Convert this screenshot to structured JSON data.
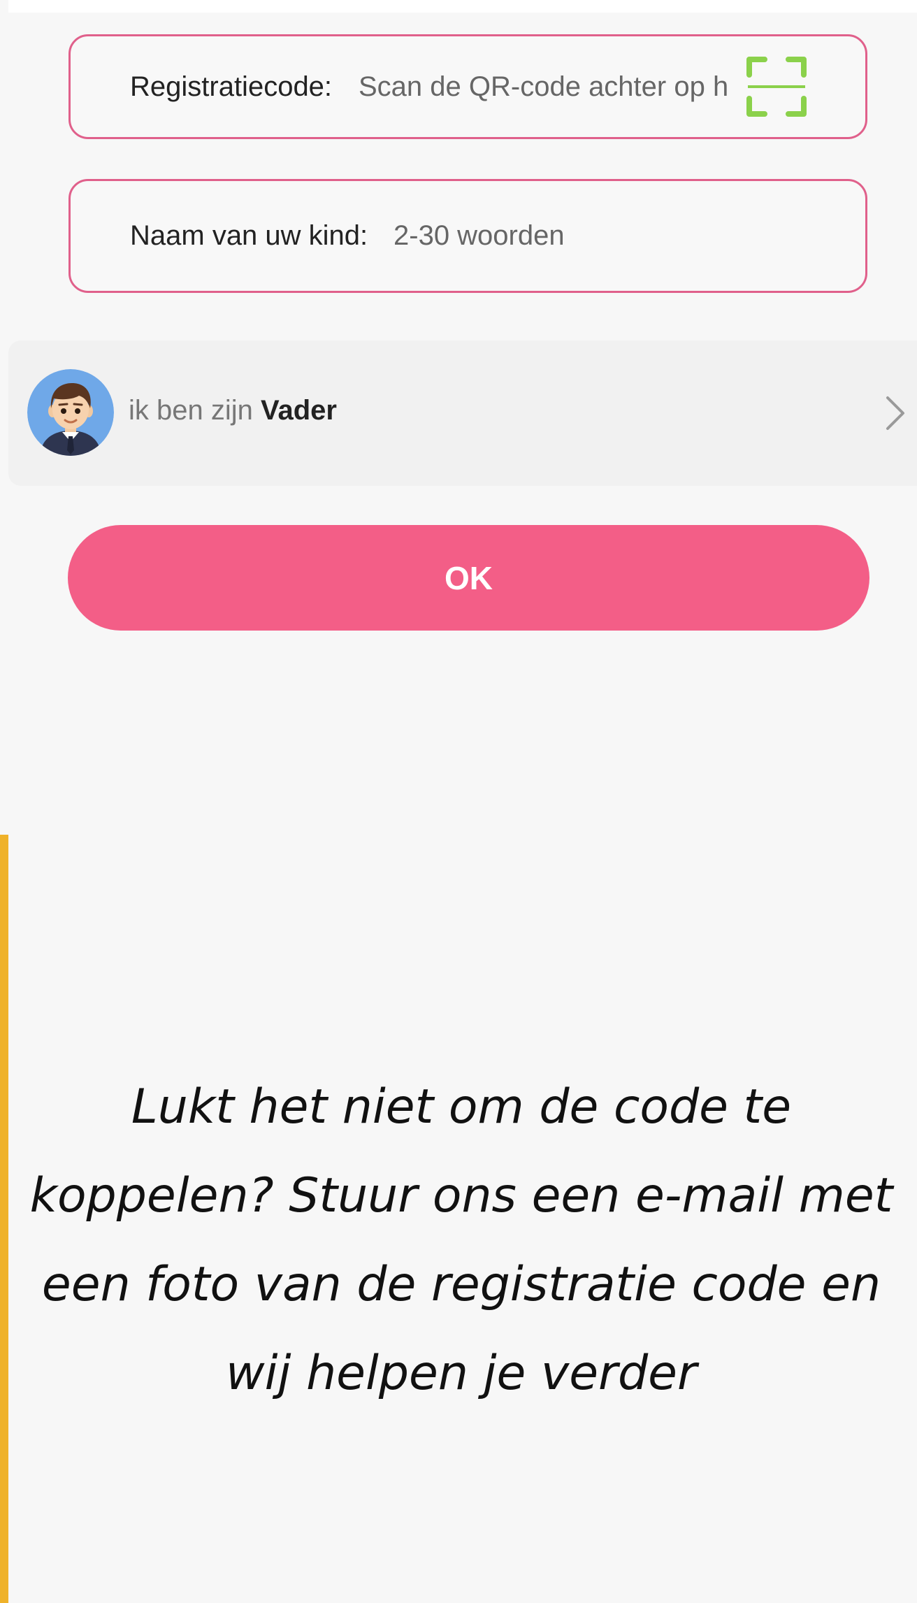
{
  "registration": {
    "label": "Registratiecode:",
    "placeholder": "Scan de QR-code achter op het horloge"
  },
  "child_name": {
    "label": "Naam van uw kind:",
    "placeholder": "2-30 woorden"
  },
  "relation": {
    "prefix": "ik ben zijn",
    "value": "Vader"
  },
  "ok_label": "OK",
  "help_message": "Lukt het niet om de code te koppelen? Stuur ons een e-mail met een foto van de registratie code en wij helpen je verder",
  "colors": {
    "accent_pink": "#F35E87",
    "field_border": "#E0608B",
    "scan_icon": "#8BD14B",
    "accent_yellow": "#EFB22A"
  },
  "icons": [
    "qr-scan-icon",
    "avatar-father",
    "chevron-right-icon"
  ]
}
